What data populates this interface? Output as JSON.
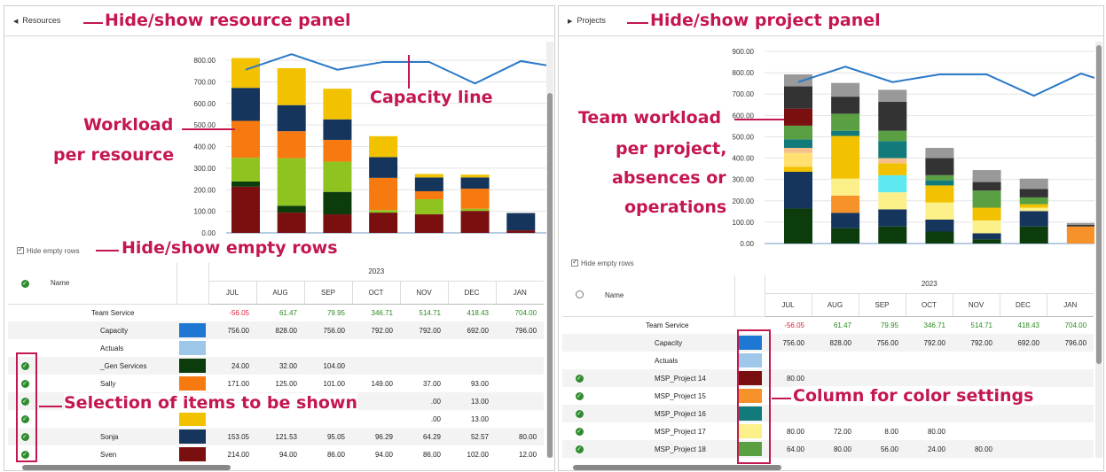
{
  "left": {
    "toggle_label": "Resources",
    "hide_empty_label": "Hide empty rows",
    "annotations": {
      "panel": "Hide/show resource panel",
      "capacity": "Capacity line",
      "workload_1": "Workload",
      "workload_2": "per resource",
      "empty_rows": "Hide/show empty rows",
      "selection": "Selection of items to be shown"
    },
    "table": {
      "year": "2023",
      "name_header": "Name",
      "months": [
        "JUL",
        "AUG",
        "SEP",
        "OCT",
        "NOV",
        "DEC",
        "JAN"
      ],
      "rows": [
        {
          "name": "Team Service",
          "indent": 0,
          "sel": "",
          "color": "",
          "values": [
            "-56.05",
            "61.47",
            "79.95",
            "346.71",
            "514.71",
            "418.43",
            "704.00"
          ],
          "colored": true
        },
        {
          "name": "Capacity",
          "indent": 1,
          "sel": "",
          "color": "#1f77d4",
          "values": [
            "756.00",
            "828.00",
            "756.00",
            "792.00",
            "792.00",
            "692.00",
            "796.00"
          ]
        },
        {
          "name": "Actuals",
          "indent": 1,
          "sel": "",
          "color": "#9ec7ea",
          "values": [
            "",
            "",
            "",
            "",
            "",
            "",
            ""
          ]
        },
        {
          "name": "_Gen Services",
          "indent": 1,
          "sel": "check",
          "color": "#0c3b0c",
          "values": [
            "24.00",
            "32.00",
            "104.00",
            "",
            "",
            "",
            ""
          ]
        },
        {
          "name": "Sally",
          "indent": 1,
          "sel": "check",
          "color": "#f77a10",
          "values": [
            "171.00",
            "125.00",
            "101.00",
            "149.00",
            "37.00",
            "93.00",
            ""
          ]
        },
        {
          "name": "",
          "indent": 1,
          "sel": "check",
          "color": "",
          "values": [
            "",
            "",
            "",
            "",
            ".00",
            "13.00",
            ""
          ]
        },
        {
          "name": "",
          "indent": 1,
          "sel": "check",
          "color": "#f2c200",
          "values": [
            "",
            "",
            "",
            "",
            ".00",
            "13.00",
            ""
          ]
        },
        {
          "name": "Sonja",
          "indent": 1,
          "sel": "check",
          "color": "#16355c",
          "values": [
            "153.05",
            "121.53",
            "95.05",
            "96.29",
            "64.29",
            "52.57",
            "80.00"
          ]
        },
        {
          "name": "Sven",
          "indent": 1,
          "sel": "check",
          "color": "#7a0f0f",
          "values": [
            "214.00",
            "94.00",
            "86.00",
            "94.00",
            "86.00",
            "102.00",
            "12.00"
          ]
        }
      ]
    }
  },
  "right": {
    "toggle_label": "Projects",
    "hide_empty_label": "Hide empty rows",
    "annotations": {
      "panel": "Hide/show project panel",
      "team_1": "Team workload",
      "team_2": "per project,",
      "team_3": "absences or",
      "team_4": "operations",
      "color_col": "Column for color settings"
    },
    "table": {
      "year": "2023",
      "name_header": "Name",
      "months": [
        "JUL",
        "AUG",
        "SEP",
        "OCT",
        "NOV",
        "DEC",
        "JAN"
      ],
      "rows": [
        {
          "name": "Team Service",
          "indent": 0,
          "sel": "",
          "color": "",
          "values": [
            "-56.05",
            "61.47",
            "79.95",
            "346.71",
            "514.71",
            "418.43",
            "704.00"
          ],
          "colored": true
        },
        {
          "name": "Capacity",
          "indent": 1,
          "sel": "",
          "color": "#1f77d4",
          "values": [
            "756.00",
            "828.00",
            "756.00",
            "792.00",
            "792.00",
            "692.00",
            "796.00"
          ]
        },
        {
          "name": "Actuals",
          "indent": 1,
          "sel": "",
          "color": "#9ec7ea",
          "values": [
            "",
            "",
            "",
            "",
            "",
            "",
            ""
          ]
        },
        {
          "name": "MSP_Project 14",
          "indent": 1,
          "sel": "check",
          "color": "#7a0f0f",
          "values": [
            "80.00",
            "",
            "",
            "",
            "",
            "",
            ""
          ]
        },
        {
          "name": "MSP_Project 15",
          "indent": 1,
          "sel": "check",
          "color": "#f7912a",
          "values": [
            "",
            "",
            "",
            "",
            "",
            "",
            ""
          ]
        },
        {
          "name": "MSP_Project 16",
          "indent": 1,
          "sel": "check",
          "color": "#127a7a",
          "values": [
            "",
            "",
            "",
            "",
            "",
            "",
            ""
          ]
        },
        {
          "name": "MSP_Project 17",
          "indent": 1,
          "sel": "check",
          "color": "#fbf08a",
          "values": [
            "80.00",
            "72.00",
            "8.00",
            "80.00",
            "",
            "",
            ""
          ]
        },
        {
          "name": "MSP_Project 18",
          "indent": 1,
          "sel": "check",
          "color": "#5aa042",
          "values": [
            "64.00",
            "80.00",
            "56.00",
            "24.00",
            "80.00",
            "",
            ""
          ]
        }
      ]
    }
  },
  "chart_data": [
    {
      "type": "bar",
      "stacked": true,
      "categories": [
        "JUL",
        "AUG",
        "SEP",
        "OCT",
        "NOV",
        "DEC",
        "JAN"
      ],
      "ylim": [
        0,
        800
      ],
      "yticks": [
        "0.00",
        "100.00",
        "200.00",
        "300.00",
        "400.00",
        "500.00",
        "600.00",
        "700.00",
        "800.00"
      ],
      "series": [
        {
          "color": "#7a0f0f",
          "values": [
            214,
            94,
            86,
            94,
            86,
            102,
            12
          ]
        },
        {
          "color": "#0c3b0c",
          "values": [
            24,
            32,
            104,
            0,
            0,
            0,
            0
          ]
        },
        {
          "color": "#8fc31f",
          "values": [
            110,
            220,
            140,
            12,
            70,
            10,
            0
          ]
        },
        {
          "color": "#f77a10",
          "values": [
            171,
            125,
            101,
            149,
            37,
            93,
            0
          ]
        },
        {
          "color": "#16355c",
          "values": [
            153,
            121,
            95,
            96,
            64,
            52,
            80
          ]
        },
        {
          "color": "#f2c200",
          "values": [
            138,
            171,
            142,
            97,
            16,
            13,
            0
          ]
        }
      ],
      "line": {
        "name": "Capacity",
        "color": "#2a78c8",
        "values": [
          756,
          828,
          756,
          792,
          792,
          692,
          796
        ]
      }
    },
    {
      "type": "bar",
      "stacked": true,
      "categories": [
        "JUL",
        "AUG",
        "SEP",
        "OCT",
        "NOV",
        "DEC",
        "JAN"
      ],
      "ylim": [
        0,
        900
      ],
      "yticks": [
        "0.00",
        "100.00",
        "200.00",
        "300.00",
        "400.00",
        "500.00",
        "600.00",
        "700.00",
        "800.00",
        "900.00"
      ],
      "series": [
        {
          "color": "#0c3b0c",
          "values": [
            164,
            72,
            80,
            56,
            20,
            80,
            0
          ]
        },
        {
          "color": "#16355c",
          "values": [
            172,
            72,
            80,
            56,
            28,
            72,
            0
          ]
        },
        {
          "color": "#f7912a",
          "values": [
            0,
            80,
            0,
            0,
            0,
            0,
            80
          ]
        },
        {
          "color": "#fbf08a",
          "values": [
            0,
            80,
            80,
            80,
            60,
            16,
            0
          ]
        },
        {
          "color": "#5ee8f0",
          "values": [
            0,
            0,
            80,
            0,
            0,
            0,
            0
          ]
        },
        {
          "color": "#f2c200",
          "values": [
            24,
            0,
            56,
            80,
            60,
            16,
            0
          ]
        },
        {
          "color": "#ffe070",
          "values": [
            64,
            0,
            0,
            0,
            0,
            0,
            0
          ]
        },
        {
          "color": "#f7c08a",
          "values": [
            24,
            0,
            24,
            0,
            0,
            0,
            0
          ]
        },
        {
          "color": "#f2c200",
          "values": [
            0,
            200,
            0,
            0,
            0,
            0,
            0
          ]
        },
        {
          "color": "#127a7a",
          "values": [
            40,
            24,
            80,
            24,
            0,
            0,
            0
          ]
        },
        {
          "color": "#5aa042",
          "values": [
            64,
            80,
            48,
            24,
            80,
            32,
            0
          ]
        },
        {
          "color": "#7a0f0f",
          "values": [
            80,
            0,
            0,
            0,
            0,
            0,
            0
          ]
        },
        {
          "color": "#333333",
          "values": [
            104,
            80,
            136,
            80,
            40,
            40,
            8
          ]
        },
        {
          "color": "#999999",
          "values": [
            56,
            64,
            56,
            48,
            56,
            48,
            8
          ]
        }
      ],
      "line": {
        "name": "Capacity",
        "color": "#2a78c8",
        "values": [
          756,
          828,
          756,
          792,
          792,
          692,
          796
        ]
      }
    }
  ]
}
